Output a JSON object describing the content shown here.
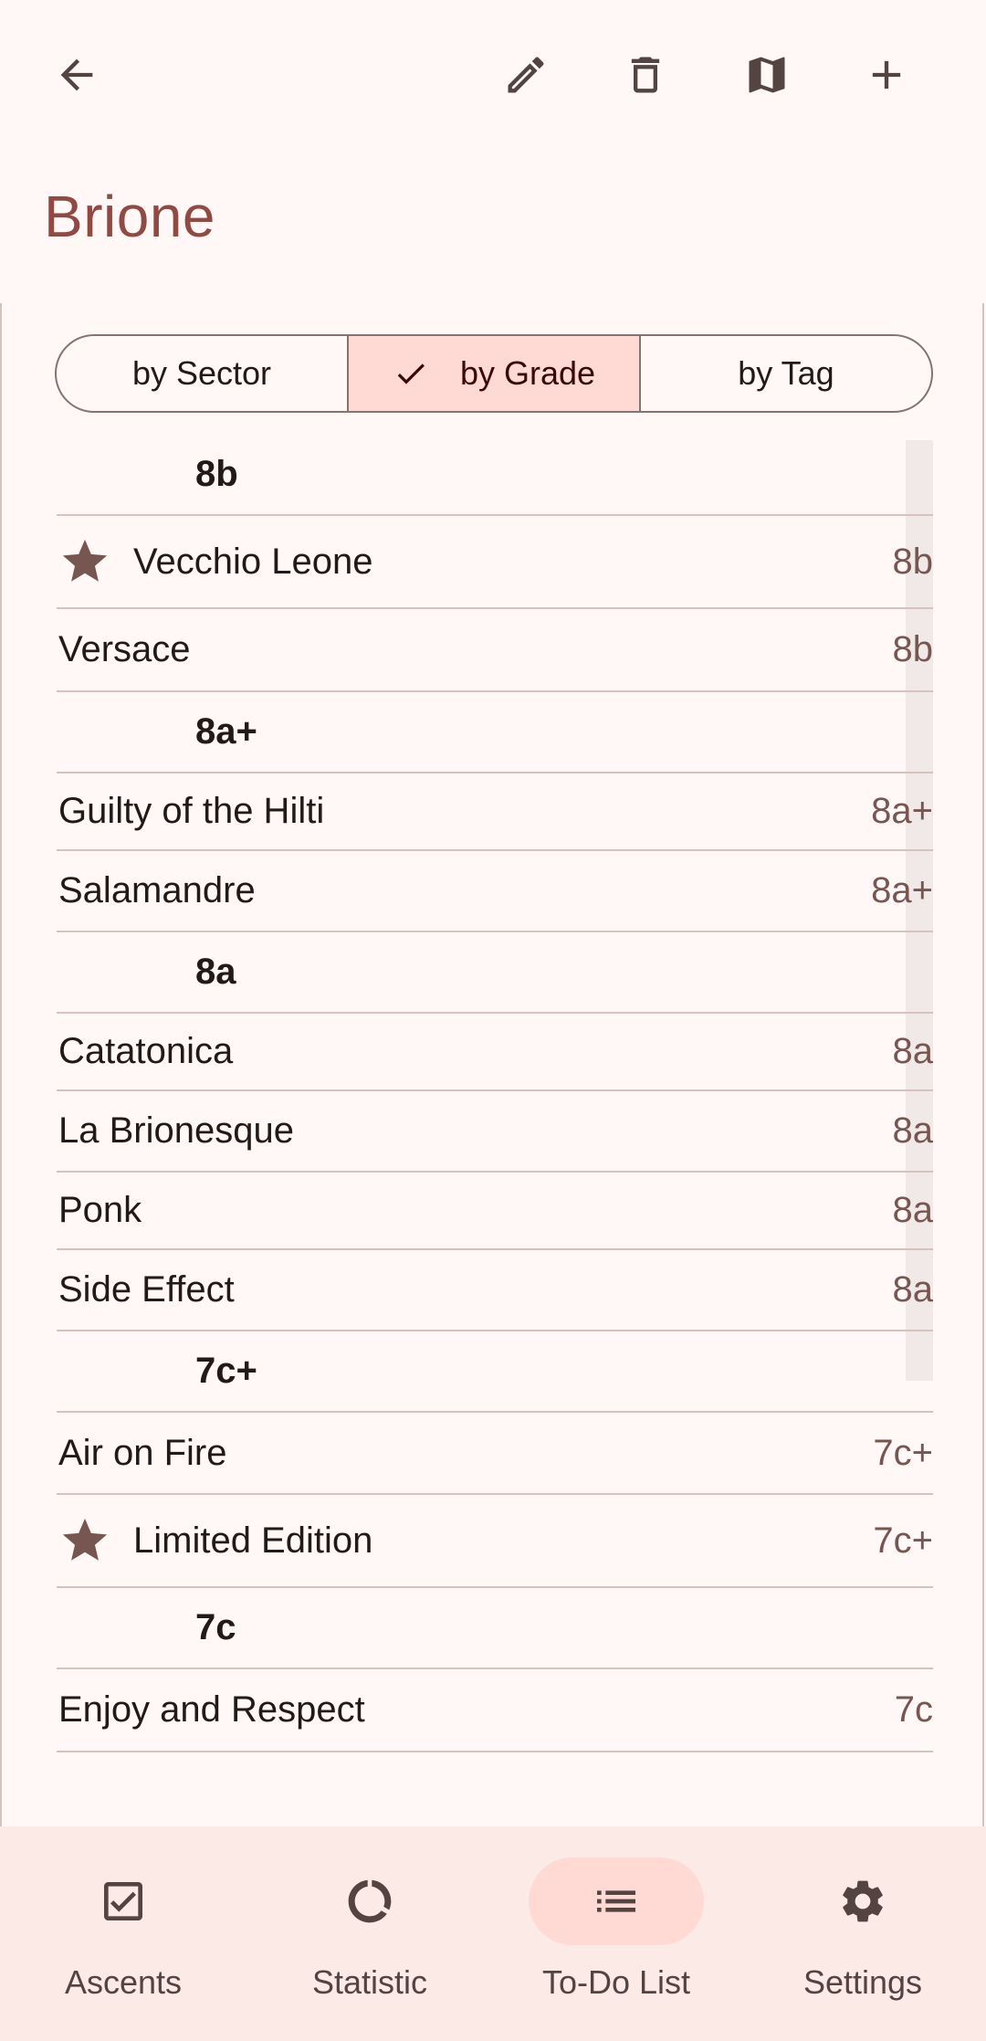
{
  "app_bar": {
    "title": "Brione",
    "icons": [
      "arrow-back-icon",
      "edit-icon",
      "delete-icon",
      "map-icon",
      "add-icon"
    ]
  },
  "filter": {
    "options": [
      "by Sector",
      "by Grade",
      "by Tag"
    ],
    "selected": "by Grade"
  },
  "list": {
    "groups": [
      {
        "grade": "8b",
        "routes": [
          {
            "name": "Vecchio Leone",
            "grade": "8b",
            "starred": true
          },
          {
            "name": "Versace",
            "grade": "8b",
            "starred": false
          }
        ]
      },
      {
        "grade": "8a+",
        "routes": [
          {
            "name": "Guilty of the Hilti",
            "grade": "8a+",
            "starred": false
          },
          {
            "name": "Salamandre",
            "grade": "8a+",
            "starred": false
          }
        ]
      },
      {
        "grade": "8a",
        "routes": [
          {
            "name": "Catatonica",
            "grade": "8a",
            "starred": false
          },
          {
            "name": "La Brionesque",
            "grade": "8a",
            "starred": false
          },
          {
            "name": "Ponk",
            "grade": "8a",
            "starred": false
          },
          {
            "name": "Side Effect",
            "grade": "8a",
            "starred": false
          }
        ]
      },
      {
        "grade": "7c+",
        "routes": [
          {
            "name": "Air on Fire",
            "grade": "7c+",
            "starred": false
          },
          {
            "name": "Limited Edition",
            "grade": "7c+",
            "starred": true
          }
        ]
      },
      {
        "grade": "7c",
        "routes": [
          {
            "name": "Enjoy and Respect",
            "grade": "7c",
            "starred": false
          }
        ]
      }
    ]
  },
  "bottom_nav": {
    "items": [
      {
        "label": "Ascents",
        "icon": "checkbox-icon"
      },
      {
        "label": "Statistic",
        "icon": "statistic-icon"
      },
      {
        "label": "To-Do List",
        "icon": "list-icon"
      },
      {
        "label": "Settings",
        "icon": "gear-icon"
      }
    ],
    "active": "To-Do List"
  },
  "colors": {
    "accent": "#904a43",
    "grade_text": "#775651",
    "selected_container": "#ffdad5",
    "background": "#fff8f6",
    "nav_background": "#fceae7"
  }
}
